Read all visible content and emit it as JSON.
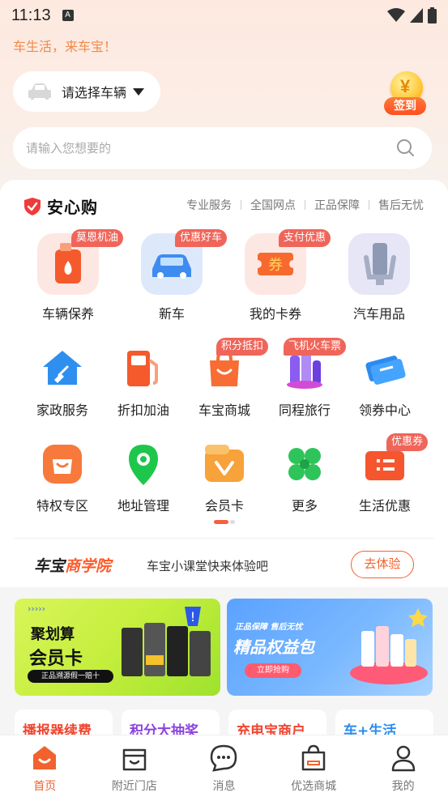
{
  "status_bar": {
    "time": "11:13",
    "a_icon": "A"
  },
  "slogan": "车生活，来车宝！",
  "car_select": {
    "label": "请选择车辆"
  },
  "sign_in": {
    "label": "签到"
  },
  "search": {
    "placeholder": "请输入您想要的"
  },
  "anxin": {
    "title": "安心购",
    "tags": [
      "专业服务",
      "全国网点",
      "正品保障",
      "售后无忧"
    ]
  },
  "big_grid": [
    {
      "label": "车辆保养",
      "badge": "莫恩机油",
      "icon": "oil-bottle-icon"
    },
    {
      "label": "新车",
      "badge": "优惠好车",
      "icon": "car-icon"
    },
    {
      "label": "我的卡券",
      "badge": "支付优惠",
      "icon": "coupon-ticket-icon"
    },
    {
      "label": "汽车用品",
      "badge": "",
      "icon": "phone-holder-icon"
    }
  ],
  "grid_row2": [
    {
      "label": "家政服务",
      "badge": "",
      "icon": "house-broom-icon"
    },
    {
      "label": "折扣加油",
      "badge": "",
      "icon": "fuel-pump-icon"
    },
    {
      "label": "车宝商城",
      "badge": "积分抵扣",
      "icon": "shopping-bag-icon"
    },
    {
      "label": "同程旅行",
      "badge": "飞机火车票",
      "icon": "travel-icon"
    },
    {
      "label": "领券中心",
      "badge": "",
      "icon": "tickets-icon"
    }
  ],
  "grid_row3": [
    {
      "label": "特权专区",
      "badge": "",
      "icon": "privilege-bag-icon"
    },
    {
      "label": "地址管理",
      "badge": "",
      "icon": "location-pin-icon"
    },
    {
      "label": "会员卡",
      "badge": "",
      "icon": "member-card-icon"
    },
    {
      "label": "更多",
      "badge": "",
      "icon": "clover-icon"
    },
    {
      "label": "生活优惠",
      "badge": "优惠券",
      "icon": "life-coupon-icon"
    }
  ],
  "academy": {
    "title_black": "车宝",
    "title_orange": "商学院",
    "desc": "车宝小课堂快来体验吧",
    "button": "去体验"
  },
  "banners": {
    "left": {
      "title1": "聚划算",
      "title2": "会员卡",
      "sub": "正品溯源假一赔十"
    },
    "right": {
      "top": "正品保障 售后无忧",
      "title": "精品权益包",
      "button": "立即抢购"
    }
  },
  "promos": [
    "播报器续费",
    "积分大抽奖",
    "充电宝商户",
    "车+生活"
  ],
  "colors": {
    "accent": "#f2622e",
    "badge": "#f0655a"
  },
  "tabbar": [
    {
      "label": "首页",
      "icon": "home-icon",
      "active": true
    },
    {
      "label": "附近门店",
      "icon": "store-icon",
      "active": false
    },
    {
      "label": "消息",
      "icon": "message-icon",
      "active": false
    },
    {
      "label": "优选商城",
      "icon": "shopping-bag-icon",
      "active": false
    },
    {
      "label": "我的",
      "icon": "person-icon",
      "active": false
    }
  ]
}
